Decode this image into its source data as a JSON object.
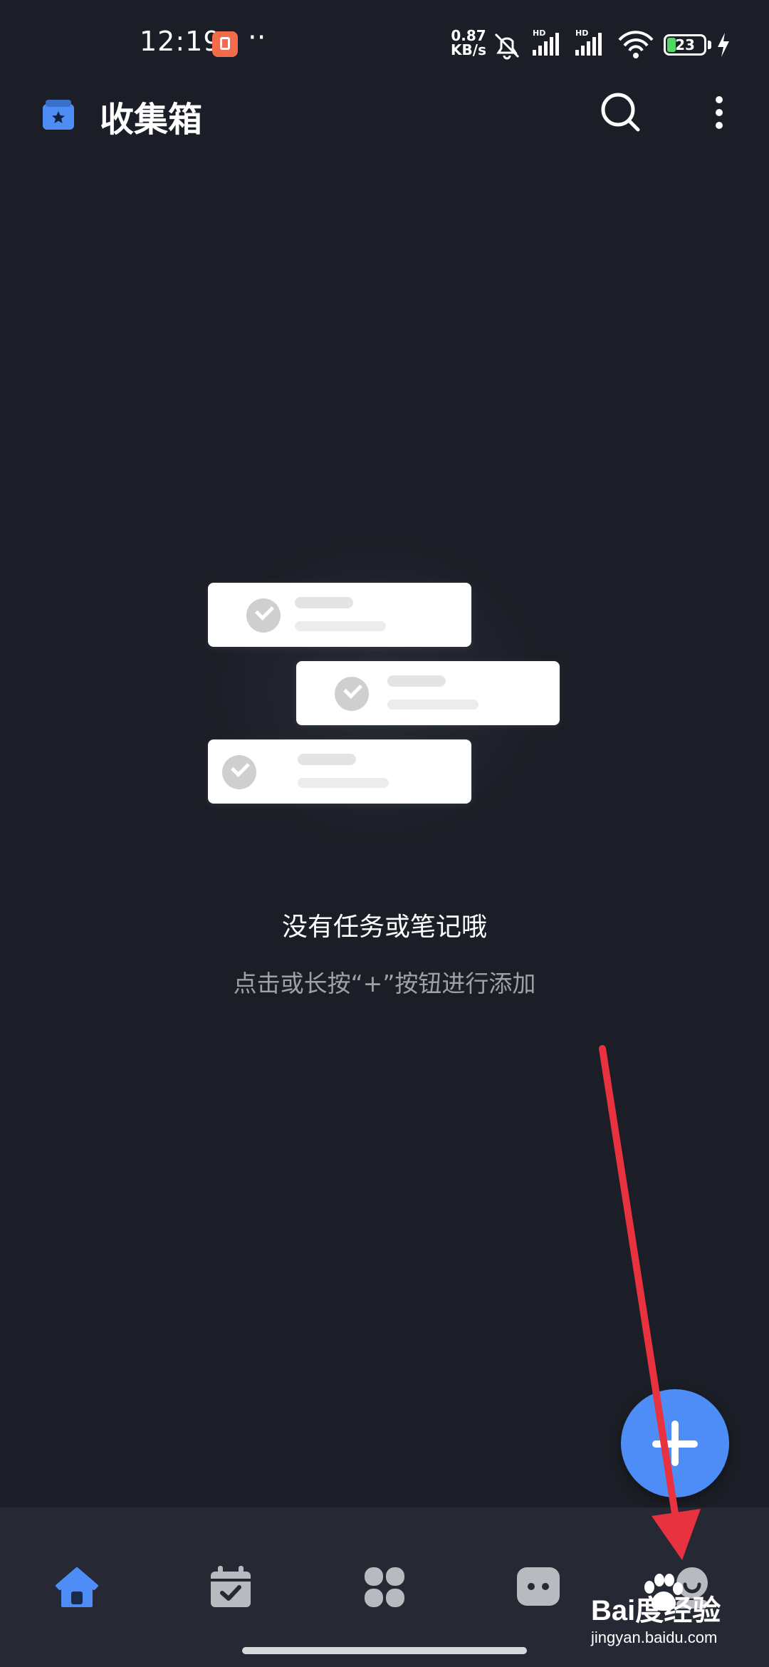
{
  "status_bar": {
    "time": "12:19",
    "dots": "··",
    "speed_value": "0.87",
    "speed_unit": "KB/s",
    "battery_level": 23,
    "battery_text": "23"
  },
  "header": {
    "title": "收集箱"
  },
  "empty_state": {
    "title": "没有任务或笔记哦",
    "hint": "点击或长按“+”按钮进行添加"
  },
  "bottom_nav": {
    "items": [
      {
        "icon": "home-icon",
        "active": true
      },
      {
        "icon": "calendar-check-icon",
        "active": false
      },
      {
        "icon": "apps-grid-icon",
        "active": false
      },
      {
        "icon": "chat-bubble-icon",
        "active": false
      },
      {
        "icon": "profile-icon",
        "active": false
      }
    ]
  },
  "colors": {
    "background": "#1b1e26",
    "accent": "#4d8df5",
    "nav_background": "#262933",
    "annotation": "#e8323f"
  },
  "watermark": {
    "logo": "Bai度经验",
    "url": "jingyan.baidu.com"
  }
}
